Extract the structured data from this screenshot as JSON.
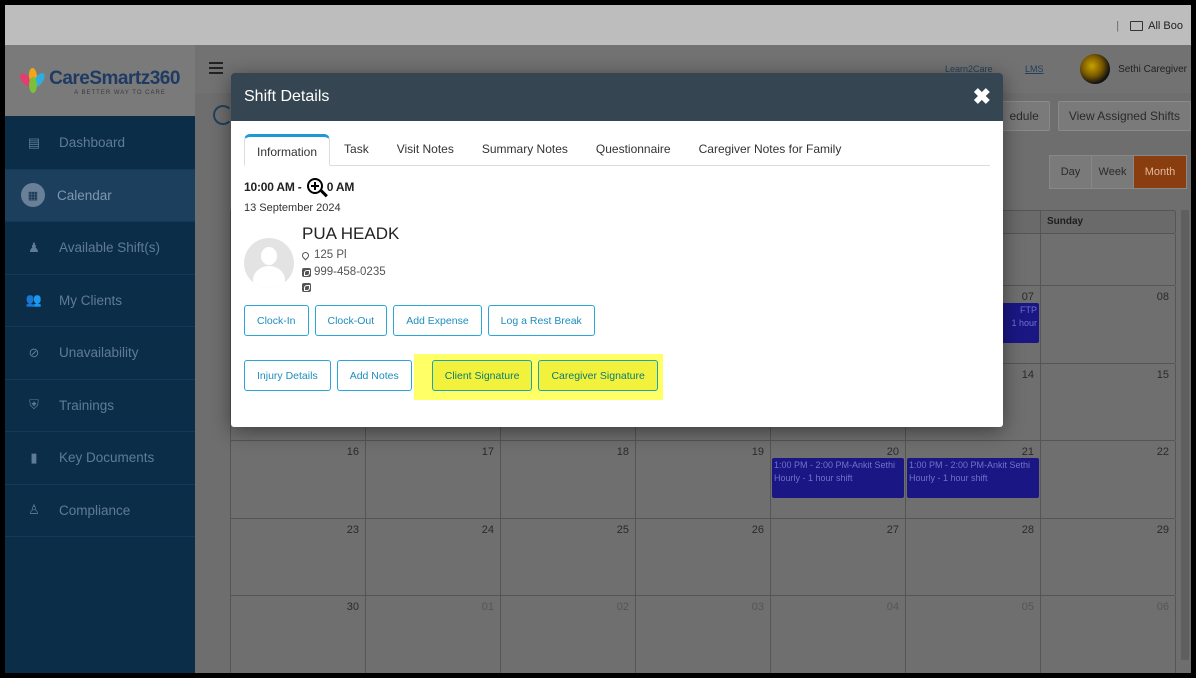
{
  "bookmarks": {
    "label": "All Boo"
  },
  "logo": {
    "brand": "CareSmartz360",
    "tagline": "A BETTER WAY TO CARE"
  },
  "sidebar": {
    "items": [
      {
        "label": "Dashboard",
        "icon": "dashboard-icon"
      },
      {
        "label": "Calendar",
        "icon": "calendar-icon",
        "active": true
      },
      {
        "label": "Available Shift(s)",
        "icon": "person-icon"
      },
      {
        "label": "My Clients",
        "icon": "clients-icon"
      },
      {
        "label": "Unavailability",
        "icon": "block-icon"
      },
      {
        "label": "Trainings",
        "icon": "training-icon"
      },
      {
        "label": "Key Documents",
        "icon": "document-icon"
      },
      {
        "label": "Compliance",
        "icon": "compliance-icon"
      }
    ]
  },
  "header": {
    "learn2care": "Learn2Care",
    "lms": "LMS",
    "user_name": "Sethi Caregiver"
  },
  "toolbar": {
    "schedule_label": "edule",
    "view_assigned": "View Assigned Shifts"
  },
  "view_switch": {
    "day": "Day",
    "week": "Week",
    "month": "Month"
  },
  "calendar": {
    "sunday": "Sunday",
    "rows": [
      [
        "",
        "",
        "",
        "",
        "",
        "",
        ""
      ],
      [
        "",
        "",
        "",
        "",
        "",
        "07",
        "08"
      ],
      [
        "",
        "",
        "",
        "",
        "",
        "14",
        "15"
      ],
      [
        "16",
        "17",
        "18",
        "19",
        "20",
        "21",
        "22"
      ],
      [
        "23",
        "24",
        "25",
        "26",
        "27",
        "28",
        "29"
      ],
      [
        "30",
        "01",
        "02",
        "03",
        "04",
        "05",
        "06"
      ]
    ],
    "events": {
      "e07": "FTP\n1 hour",
      "e20": "1:00 PM - 2:00 PM-Ankit Sethi Hourly - 1 hour shift",
      "e21": "1:00 PM - 2:00 PM-Ankit Sethi Hourly - 1 hour shift"
    }
  },
  "modal": {
    "title": "Shift Details",
    "close": "✖",
    "tabs": [
      "Information",
      "Task",
      "Visit Notes",
      "Summary Notes",
      "Questionnaire",
      "Caregiver Notes for Family"
    ],
    "time": "10:00 AM - ",
    "time_end": "0 AM",
    "date": "13 September 2024",
    "client_name": "PUA HEADK",
    "address": "125 Pl",
    "phone": "999-458-0235",
    "buttons_row1": [
      "Clock-In",
      "Clock-Out",
      "Add Expense",
      "Log a Rest Break"
    ],
    "buttons_row2": [
      "Injury Details",
      "Add Notes",
      "Client Signature",
      "Caregiver Signature"
    ]
  },
  "colors": {
    "accent": "#1f98d8",
    "header": "#354652",
    "highlight": "#ffff66",
    "sidebar": "#0c2d48"
  }
}
